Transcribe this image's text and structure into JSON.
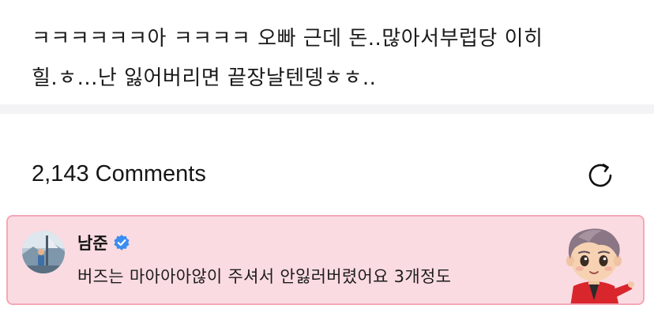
{
  "post": {
    "body": "ㅋㅋㅋㅋㅋㅋ아 ㅋㅋㅋㅋ 오빠 근데 돈..많아서부럽당 이히\n힐.ㅎ...난 잃어버리면 끝장날텐뎅ㅎㅎ.."
  },
  "comments": {
    "count_label": "2,143 Comments",
    "refresh_icon": "refresh-icon"
  },
  "highlighted_comment": {
    "author": "남준",
    "verified_icon": "verified-badge-icon",
    "text": "버즈는 마아아아않이 주셔서 안잃러버렸어요 3개정도",
    "sticker": "character-sticker",
    "colors": {
      "background": "#fadbe1",
      "border": "#f3a9b6",
      "verified": "#3b8df1"
    }
  }
}
